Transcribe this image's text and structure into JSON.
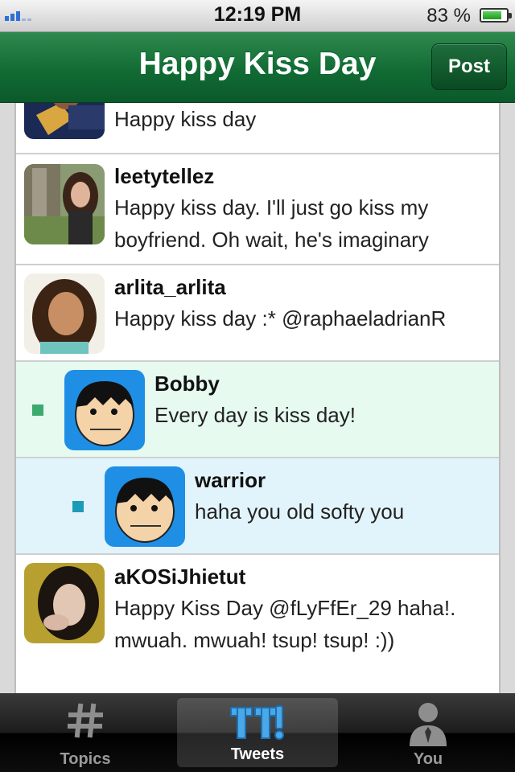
{
  "status_bar": {
    "time": "12:19 PM",
    "battery_percent": "83 %",
    "battery_level": 0.83
  },
  "nav": {
    "title": "Happy Kiss Day",
    "post_label": "Post"
  },
  "tweets": [
    {
      "username": "",
      "text": "Happy kiss day",
      "partial": true
    },
    {
      "username": "leetytellez",
      "text": "Happy kiss day. I'll just go kiss my boyfriend. Oh wait, he's imaginary"
    },
    {
      "username": "arlita_arlita",
      "text": "Happy kiss day :* @raphaeladrianR"
    },
    {
      "username": "Bobby",
      "text": "Every day is kiss day!",
      "reply_level": 1,
      "highlight": "#e6faf0",
      "marker_color": "#3daa6d"
    },
    {
      "username": "warrior",
      "text": "haha you old softy you",
      "reply_level": 2,
      "highlight": "#e2f4fb",
      "marker_color": "#1b9bb8"
    },
    {
      "username": "aKOSiJhietut",
      "text": "Happy Kiss Day @fLyFfEr_29 haha!. mwuah. mwuah! tsup! tsup! :))"
    }
  ],
  "tabs": [
    {
      "label": "Topics",
      "icon": "hash-icon",
      "active": false
    },
    {
      "label": "Tweets",
      "icon": "tweets-logo-icon",
      "active": true
    },
    {
      "label": "You",
      "icon": "person-icon",
      "active": false
    }
  ],
  "colors": {
    "nav_green": "#116b33",
    "reply_green": "#e6faf0",
    "reply_blue": "#e2f4fb",
    "avatar_blue": "#1f8fe6"
  }
}
